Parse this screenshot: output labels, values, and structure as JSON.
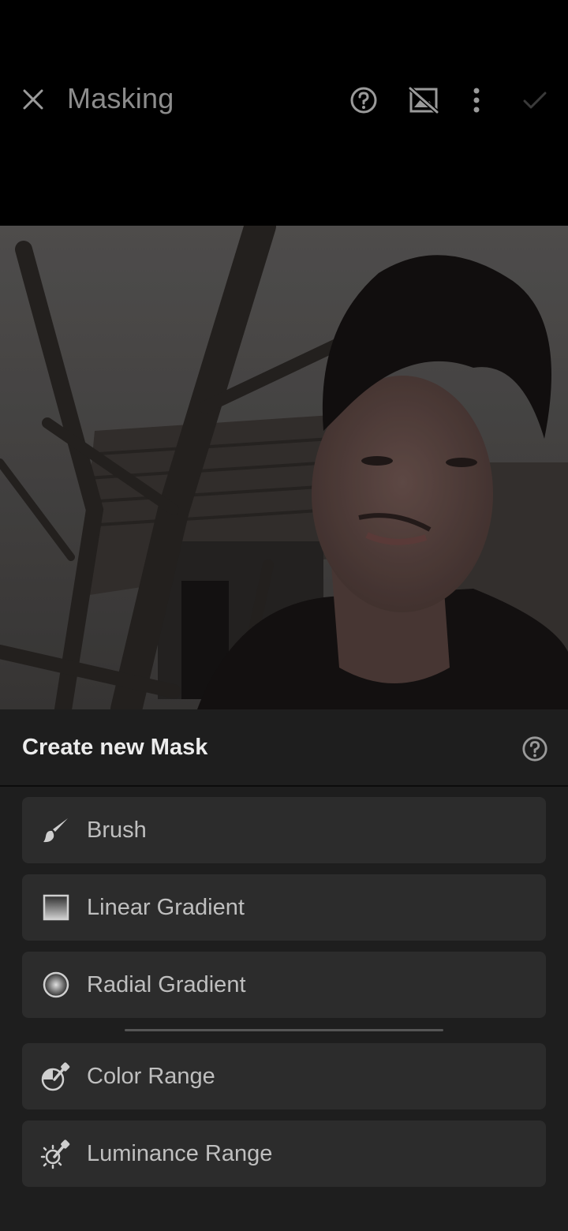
{
  "header": {
    "title": "Masking",
    "close_icon": "close-icon",
    "help_icon": "help-icon",
    "overlay_toggle_icon": "overlay-off-icon",
    "more_icon": "more-vertical-icon",
    "confirm_icon": "check-icon"
  },
  "panel": {
    "title": "Create new Mask",
    "help_icon": "help-icon",
    "options": [
      {
        "label": "Brush",
        "icon": "brush-icon"
      },
      {
        "label": "Linear Gradient",
        "icon": "linear-gradient-icon"
      },
      {
        "label": "Radial Gradient",
        "icon": "radial-gradient-icon"
      },
      {
        "label": "Color Range",
        "icon": "color-range-icon"
      },
      {
        "label": "Luminance Range",
        "icon": "luminance-range-icon"
      }
    ]
  },
  "colors": {
    "background": "#000000",
    "panel": "#1e1e1e",
    "option_bg": "#2c2c2c",
    "text_primary": "#ececec",
    "text_secondary": "#bfbfbf"
  }
}
